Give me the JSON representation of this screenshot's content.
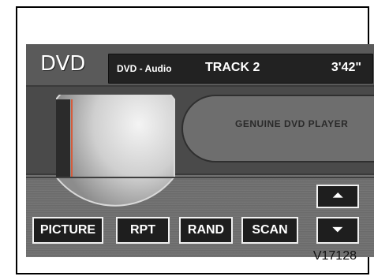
{
  "header": {
    "title": "DVD"
  },
  "info": {
    "format": "DVD - Audio",
    "track": "TRACK  2",
    "time": "3'42\""
  },
  "display": {
    "plate_text": "GENUINE DVD PLAYER"
  },
  "buttons": {
    "picture": "PICTURE",
    "rpt": "RPT",
    "rand": "RAND",
    "scan": "SCAN"
  },
  "arrows": {
    "up": "⏶",
    "down": "⏷"
  },
  "caption": "V17128"
}
